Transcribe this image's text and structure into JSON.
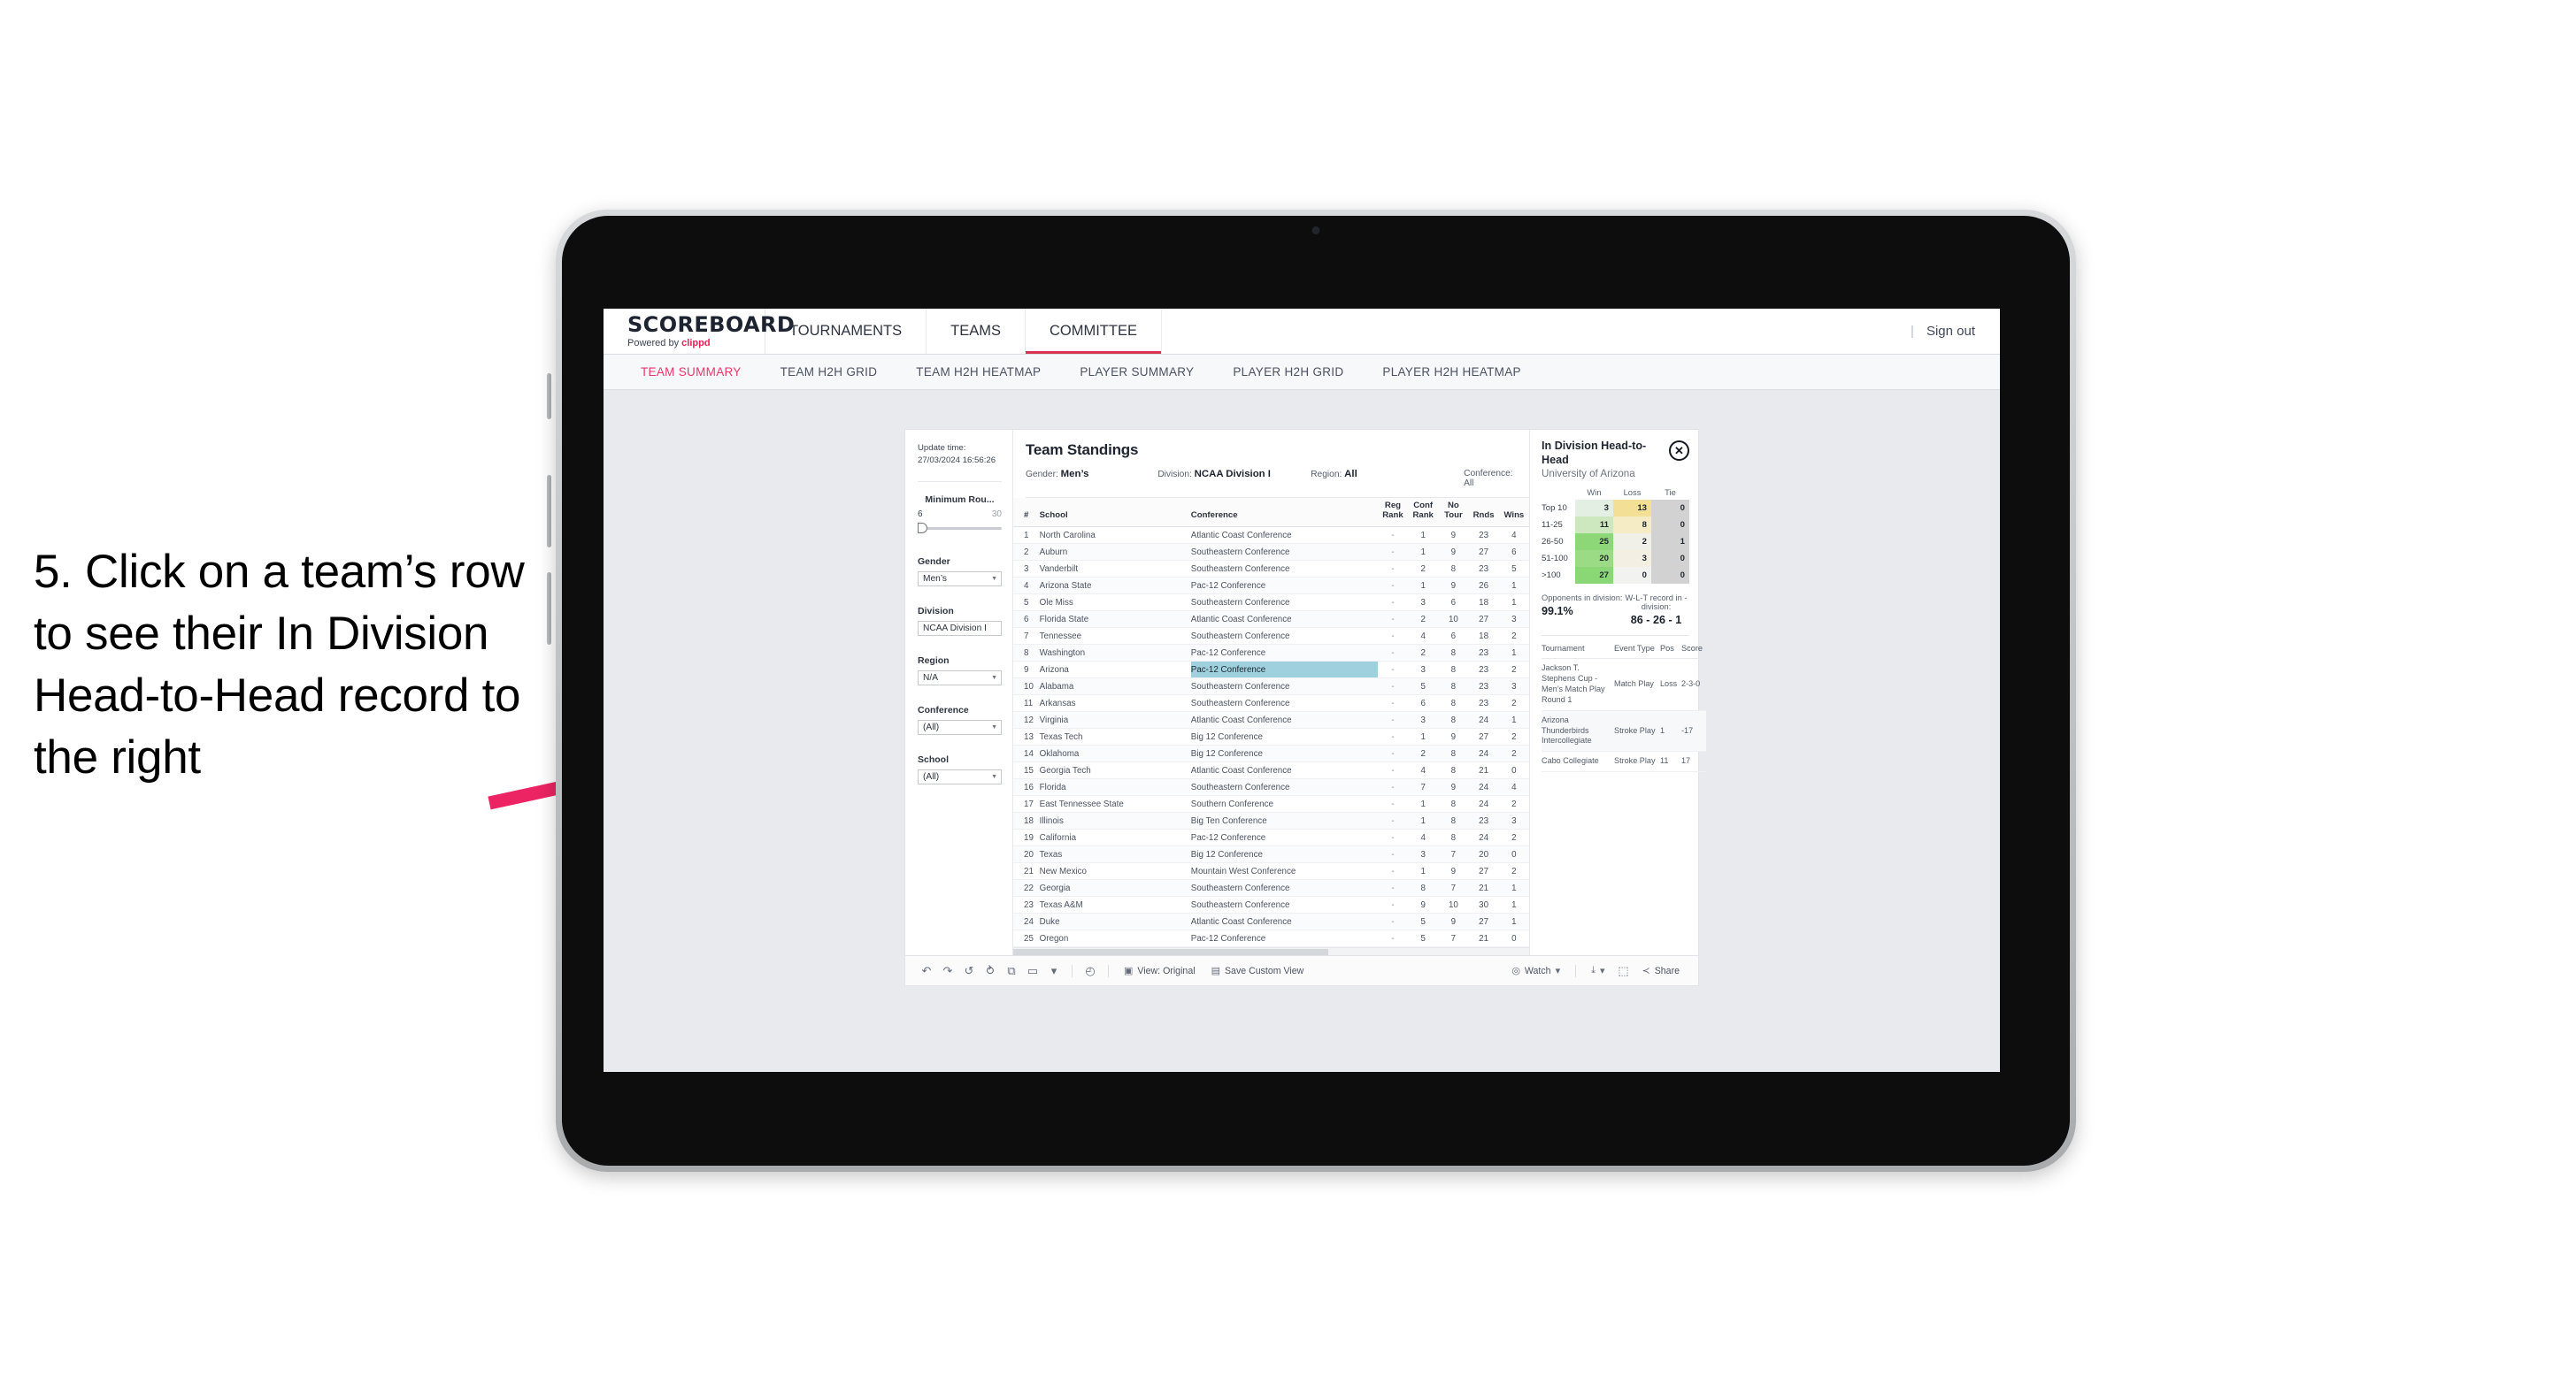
{
  "annotation": {
    "text": "5. Click on a team’s row to see their In Division Head-to-Head record to the right",
    "arrow_color": "#ec2463"
  },
  "app": {
    "brand": {
      "title": "SCOREBOARD",
      "powered_prefix": "Powered by ",
      "powered_brand": "clippd"
    },
    "topnav": [
      {
        "label": "TOURNAMENTS",
        "active": false
      },
      {
        "label": "TEAMS",
        "active": false
      },
      {
        "label": "COMMITTEE",
        "active": true
      }
    ],
    "topnav_right": {
      "divider": "|",
      "sign_out": "Sign out"
    },
    "subnav": [
      {
        "label": "TEAM SUMMARY",
        "active": true
      },
      {
        "label": "TEAM H2H GRID",
        "active": false
      },
      {
        "label": "TEAM H2H HEATMAP",
        "active": false
      },
      {
        "label": "PLAYER SUMMARY",
        "active": false
      },
      {
        "label": "PLAYER H2H GRID",
        "active": false
      },
      {
        "label": "PLAYER H2H HEATMAP",
        "active": false
      }
    ]
  },
  "filters": {
    "update_time_label": "Update time:",
    "update_time_value": "27/03/2024 16:56:26",
    "min_rounds": {
      "label": "Minimum Rou...",
      "min": "6",
      "max": "30"
    },
    "gender": {
      "label": "Gender",
      "value": "Men’s"
    },
    "division": {
      "label": "Division",
      "value": "NCAA Division I"
    },
    "region": {
      "label": "Region",
      "value": "N/A"
    },
    "conference": {
      "label": "Conference",
      "value": "(All)"
    },
    "school": {
      "label": "School",
      "value": "(All)"
    }
  },
  "standings": {
    "title": "Team Standings",
    "meta": {
      "gender_label": "Gender:",
      "gender_value": "Men’s",
      "division_label": "Division:",
      "division_value": "NCAA Division I",
      "region_label": "Region:",
      "region_value": "All",
      "conference_label": "Conference:",
      "conference_value": "All"
    },
    "columns": [
      "#",
      "School",
      "Conference",
      "Reg Rank",
      "Conf Rank",
      "No Tour",
      "Rnds",
      "Wins"
    ],
    "column_lines": [
      [
        "#"
      ],
      [
        "School"
      ],
      [
        "Conference"
      ],
      [
        "Reg",
        "Rank"
      ],
      [
        "Conf",
        "Rank"
      ],
      [
        "No",
        "Tour"
      ],
      [
        "Rnds"
      ],
      [
        "Wins"
      ]
    ],
    "rows": [
      {
        "rank": "1",
        "school": "North Carolina",
        "conference": "Atlantic Coast Conference",
        "reg": "-",
        "conf": "1",
        "notour": "9",
        "rnds": "23",
        "wins": "4",
        "selected": false
      },
      {
        "rank": "2",
        "school": "Auburn",
        "conference": "Southeastern Conference",
        "reg": "-",
        "conf": "1",
        "notour": "9",
        "rnds": "27",
        "wins": "6",
        "selected": false
      },
      {
        "rank": "3",
        "school": "Vanderbilt",
        "conference": "Southeastern Conference",
        "reg": "-",
        "conf": "2",
        "notour": "8",
        "rnds": "23",
        "wins": "5",
        "selected": false
      },
      {
        "rank": "4",
        "school": "Arizona State",
        "conference": "Pac-12 Conference",
        "reg": "-",
        "conf": "1",
        "notour": "9",
        "rnds": "26",
        "wins": "1",
        "selected": false
      },
      {
        "rank": "5",
        "school": "Ole Miss",
        "conference": "Southeastern Conference",
        "reg": "-",
        "conf": "3",
        "notour": "6",
        "rnds": "18",
        "wins": "1",
        "selected": false
      },
      {
        "rank": "6",
        "school": "Florida State",
        "conference": "Atlantic Coast Conference",
        "reg": "-",
        "conf": "2",
        "notour": "10",
        "rnds": "27",
        "wins": "3",
        "selected": false
      },
      {
        "rank": "7",
        "school": "Tennessee",
        "conference": "Southeastern Conference",
        "reg": "-",
        "conf": "4",
        "notour": "6",
        "rnds": "18",
        "wins": "2",
        "selected": false
      },
      {
        "rank": "8",
        "school": "Washington",
        "conference": "Pac-12 Conference",
        "reg": "-",
        "conf": "2",
        "notour": "8",
        "rnds": "23",
        "wins": "1",
        "selected": false
      },
      {
        "rank": "9",
        "school": "Arizona",
        "conference": "Pac-12 Conference",
        "reg": "-",
        "conf": "3",
        "notour": "8",
        "rnds": "23",
        "wins": "2",
        "selected": true
      },
      {
        "rank": "10",
        "school": "Alabama",
        "conference": "Southeastern Conference",
        "reg": "-",
        "conf": "5",
        "notour": "8",
        "rnds": "23",
        "wins": "3",
        "selected": false
      },
      {
        "rank": "11",
        "school": "Arkansas",
        "conference": "Southeastern Conference",
        "reg": "-",
        "conf": "6",
        "notour": "8",
        "rnds": "23",
        "wins": "2",
        "selected": false
      },
      {
        "rank": "12",
        "school": "Virginia",
        "conference": "Atlantic Coast Conference",
        "reg": "-",
        "conf": "3",
        "notour": "8",
        "rnds": "24",
        "wins": "1",
        "selected": false
      },
      {
        "rank": "13",
        "school": "Texas Tech",
        "conference": "Big 12 Conference",
        "reg": "-",
        "conf": "1",
        "notour": "9",
        "rnds": "27",
        "wins": "2",
        "selected": false
      },
      {
        "rank": "14",
        "school": "Oklahoma",
        "conference": "Big 12 Conference",
        "reg": "-",
        "conf": "2",
        "notour": "8",
        "rnds": "24",
        "wins": "2",
        "selected": false
      },
      {
        "rank": "15",
        "school": "Georgia Tech",
        "conference": "Atlantic Coast Conference",
        "reg": "-",
        "conf": "4",
        "notour": "8",
        "rnds": "21",
        "wins": "0",
        "selected": false
      },
      {
        "rank": "16",
        "school": "Florida",
        "conference": "Southeastern Conference",
        "reg": "-",
        "conf": "7",
        "notour": "9",
        "rnds": "24",
        "wins": "4",
        "selected": false
      },
      {
        "rank": "17",
        "school": "East Tennessee State",
        "conference": "Southern Conference",
        "reg": "-",
        "conf": "1",
        "notour": "8",
        "rnds": "24",
        "wins": "2",
        "selected": false
      },
      {
        "rank": "18",
        "school": "Illinois",
        "conference": "Big Ten Conference",
        "reg": "-",
        "conf": "1",
        "notour": "8",
        "rnds": "23",
        "wins": "3",
        "selected": false
      },
      {
        "rank": "19",
        "school": "California",
        "conference": "Pac-12 Conference",
        "reg": "-",
        "conf": "4",
        "notour": "8",
        "rnds": "24",
        "wins": "2",
        "selected": false
      },
      {
        "rank": "20",
        "school": "Texas",
        "conference": "Big 12 Conference",
        "reg": "-",
        "conf": "3",
        "notour": "7",
        "rnds": "20",
        "wins": "0",
        "selected": false
      },
      {
        "rank": "21",
        "school": "New Mexico",
        "conference": "Mountain West Conference",
        "reg": "-",
        "conf": "1",
        "notour": "9",
        "rnds": "27",
        "wins": "2",
        "selected": false
      },
      {
        "rank": "22",
        "school": "Georgia",
        "conference": "Southeastern Conference",
        "reg": "-",
        "conf": "8",
        "notour": "7",
        "rnds": "21",
        "wins": "1",
        "selected": false
      },
      {
        "rank": "23",
        "school": "Texas A&M",
        "conference": "Southeastern Conference",
        "reg": "-",
        "conf": "9",
        "notour": "10",
        "rnds": "30",
        "wins": "1",
        "selected": false
      },
      {
        "rank": "24",
        "school": "Duke",
        "conference": "Atlantic Coast Conference",
        "reg": "-",
        "conf": "5",
        "notour": "9",
        "rnds": "27",
        "wins": "1",
        "selected": false
      },
      {
        "rank": "25",
        "school": "Oregon",
        "conference": "Pac-12 Conference",
        "reg": "-",
        "conf": "5",
        "notour": "7",
        "rnds": "21",
        "wins": "0",
        "selected": false
      }
    ]
  },
  "h2h": {
    "title": "In Division Head-to-Head",
    "subtitle": "University of Arizona",
    "close_icon": "✕",
    "columns": [
      "Win",
      "Loss",
      "Tie"
    ],
    "rows": [
      {
        "band": "Top 10",
        "win": "3",
        "loss": "13",
        "tie": "0",
        "win_color": "#e3efe2",
        "loss_color": "#f3e096",
        "tie_color": "#d2d2d2"
      },
      {
        "band": "11-25",
        "win": "11",
        "loss": "8",
        "tie": "0",
        "win_color": "#cde8bf",
        "loss_color": "#f5ecc6",
        "tie_color": "#d2d2d2"
      },
      {
        "band": "26-50",
        "win": "25",
        "loss": "2",
        "tie": "1",
        "win_color": "#8ed778",
        "loss_color": "#f0efe8",
        "tie_color": "#d2d2d2"
      },
      {
        "band": "51-100",
        "win": "20",
        "loss": "3",
        "tie": "0",
        "win_color": "#9bdb86",
        "loss_color": "#f3efe2",
        "tie_color": "#d2d2d2"
      },
      {
        "band": ">100",
        "win": "27",
        "loss": "0",
        "tie": "0",
        "win_color": "#8ad775",
        "loss_color": "#f2f2f0",
        "tie_color": "#d2d2d2"
      }
    ],
    "summary": {
      "opponents_label": "Opponents in division:",
      "opponents_value": "99.1%",
      "record_label": "W-L-T record in -division:",
      "record_value": "86 - 26 - 1"
    },
    "tour_columns": [
      "Tournament",
      "Event Type",
      "Pos",
      "Score"
    ],
    "tournaments": [
      {
        "name": "Jackson T. Stephens Cup - Men’s Match Play Round 1",
        "type": "Match Play",
        "pos": "Loss",
        "score": "2-3-0"
      },
      {
        "name": "Arizona Thunderbirds Intercollegiate",
        "type": "Stroke Play",
        "pos": "1",
        "score": "-17"
      },
      {
        "name": "Cabo Collegiate",
        "type": "Stroke Play",
        "pos": "11",
        "score": "17"
      }
    ]
  },
  "toolbar": {
    "icons": [
      "undo-icon",
      "redo-icon",
      "revert-icon",
      "refresh-icon",
      "pause-icon",
      "shape-icon",
      "caret-icon"
    ],
    "undo": "↶",
    "redo": "↷",
    "revert": "↺",
    "refresh": "⥁",
    "pause": "⧉",
    "shape": "▭",
    "caret": "▾",
    "clock": "◴",
    "view_label": "View: Original",
    "view_icon": "▣",
    "save_label": "Save Custom View",
    "save_icon": "▤",
    "watch_label": "Watch",
    "watch_icon": "◎",
    "download_icon": "⤓",
    "fullscreen_icon": "⬚",
    "share_label": "Share",
    "share_icon": "≺"
  }
}
